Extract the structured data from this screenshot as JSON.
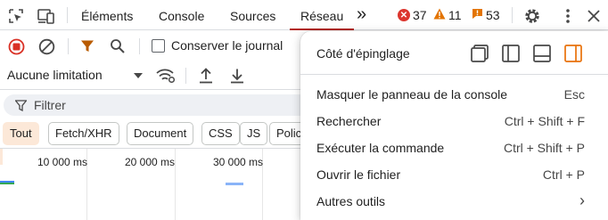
{
  "tabs": {
    "elements": "Éléments",
    "console": "Console",
    "sources": "Sources",
    "network": "Réseau",
    "more": "»"
  },
  "counts": {
    "errors": "37",
    "warnings": "11",
    "issues": "53"
  },
  "toolbar": {
    "preserve_log": "Conserver le journal",
    "throttling": "Aucune limitation"
  },
  "filter": {
    "placeholder": "Filtrer"
  },
  "type_filters": [
    "Tout",
    "Fetch/XHR",
    "Document",
    "CSS",
    "JS",
    "Polic"
  ],
  "timeline": {
    "ticks": [
      "10 000 ms",
      "20 000 ms",
      "30 000 ms"
    ]
  },
  "menu": {
    "dock_label": "Côté d'épinglage",
    "items": [
      {
        "label": "Masquer le panneau de la console",
        "shortcut": "Esc"
      },
      {
        "label": "Rechercher",
        "shortcut": "Ctrl + Shift + F"
      },
      {
        "label": "Exécuter la commande",
        "shortcut": "Ctrl + Shift + P"
      },
      {
        "label": "Ouvrir le fichier",
        "shortcut": "Ctrl + P"
      },
      {
        "label": "Autres outils",
        "shortcut": "›"
      }
    ]
  },
  "colors": {
    "accent_tab": "#b3261e",
    "error": "#dc362e",
    "warning": "#e37400",
    "record": "#d93025",
    "dock_active": "#e8710a"
  }
}
